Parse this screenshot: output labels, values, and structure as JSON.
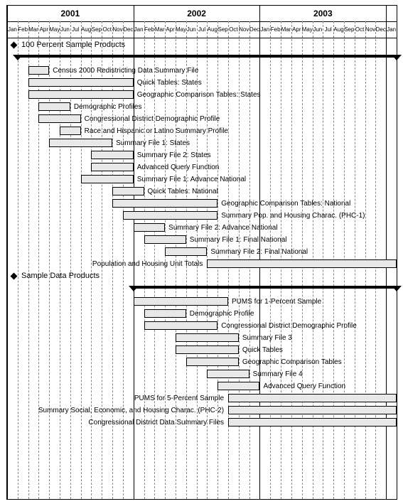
{
  "chart_data": {
    "type": "gantt",
    "title": "",
    "time_axis": {
      "unit": "month",
      "start": "2001-01",
      "end": "2004-01",
      "months": [
        "Jan",
        "Feb",
        "Mar",
        "Apr",
        "May",
        "Jun",
        "Jul",
        "Aug",
        "Sep",
        "Oct",
        "Nov",
        "Dec"
      ],
      "years": [
        "2001",
        "2002",
        "2003"
      ]
    },
    "sections": [
      {
        "name": "100 Percent Sample Products",
        "span_start": "2001-02",
        "span_end": "2004-01",
        "tasks": [
          {
            "label": "Census 2000 Redistricting Data Summary File",
            "start": "2001-03",
            "end": "2001-04",
            "label_side": "right"
          },
          {
            "label": "Quick Tables: States",
            "start": "2001-03",
            "end": "2001-12",
            "label_side": "right"
          },
          {
            "label": "Geographic Comparison Tables: States",
            "start": "2001-03",
            "end": "2001-12",
            "label_side": "right"
          },
          {
            "label": "Demographic Profiles",
            "start": "2001-04",
            "end": "2001-06",
            "label_side": "right"
          },
          {
            "label": "Congressional District Demographic Profile",
            "start": "2001-04",
            "end": "2001-07",
            "label_side": "right"
          },
          {
            "label": "Race and Hispanic or Latino Summary Profile",
            "start": "2001-06",
            "end": "2001-07",
            "label_side": "right"
          },
          {
            "label": "Summary File 1: States",
            "start": "2001-05",
            "end": "2001-10",
            "label_side": "right"
          },
          {
            "label": "Summary File 2: States",
            "start": "2001-09",
            "end": "2001-12",
            "label_side": "right"
          },
          {
            "label": "Advanced Query Function",
            "start": "2001-09",
            "end": "2001-12",
            "label_side": "right"
          },
          {
            "label": "Summary File 1: Advance National",
            "start": "2001-08",
            "end": "2001-12",
            "label_side": "right"
          },
          {
            "label": "Quick Tables: National",
            "start": "2001-11",
            "end": "2002-01",
            "label_side": "right"
          },
          {
            "label": "Geographic Comparison Tables: National",
            "start": "2001-11",
            "end": "2002-08",
            "label_side": "right"
          },
          {
            "label": "Summary Pop. and Housing Charac. (PHC-1)",
            "start": "2001-12",
            "end": "2002-08",
            "label_side": "right"
          },
          {
            "label": "Summary File 2: Advance National",
            "start": "2002-01",
            "end": "2002-03",
            "label_side": "right"
          },
          {
            "label": "Summary File 1: Final National",
            "start": "2002-02",
            "end": "2002-05",
            "label_side": "right"
          },
          {
            "label": "Summary File 2: Final National",
            "start": "2002-04",
            "end": "2002-07",
            "label_side": "right"
          },
          {
            "label": "Population and Housing Unit Totals",
            "start": "2002-08",
            "end": "2004-01",
            "label_side": "left"
          }
        ]
      },
      {
        "name": "Sample Data Products",
        "span_start": "2002-01",
        "span_end": "2004-01",
        "tasks": [
          {
            "label": "PUMS for 1-Percent Sample",
            "start": "2002-01",
            "end": "2002-09",
            "label_side": "right"
          },
          {
            "label": "Demographic Profile",
            "start": "2002-02",
            "end": "2002-05",
            "label_side": "right"
          },
          {
            "label": "Congressional District Demographic Profile",
            "start": "2002-02",
            "end": "2002-08",
            "label_side": "right"
          },
          {
            "label": "Summary File 3",
            "start": "2002-05",
            "end": "2002-10",
            "label_side": "right"
          },
          {
            "label": "Quick Tables",
            "start": "2002-05",
            "end": "2002-10",
            "label_side": "right"
          },
          {
            "label": "Geographic Comparison Tables",
            "start": "2002-06",
            "end": "2002-10",
            "label_side": "right"
          },
          {
            "label": "Summary File 4",
            "start": "2002-08",
            "end": "2002-11",
            "label_side": "right"
          },
          {
            "label": "Advanced Query Function",
            "start": "2002-09",
            "end": "2002-12",
            "label_side": "right"
          },
          {
            "label": "PUMS for 5-Percent Sample",
            "start": "2002-10",
            "end": "2004-01",
            "label_side": "left"
          },
          {
            "label": "Summary Social, Economic, and Housing Charac. (PHC-2)",
            "start": "2002-10",
            "end": "2004-01",
            "label_side": "left"
          },
          {
            "label": "Congressional District Data Summary Files",
            "start": "2002-10",
            "end": "2004-01",
            "label_side": "left"
          }
        ]
      }
    ]
  }
}
